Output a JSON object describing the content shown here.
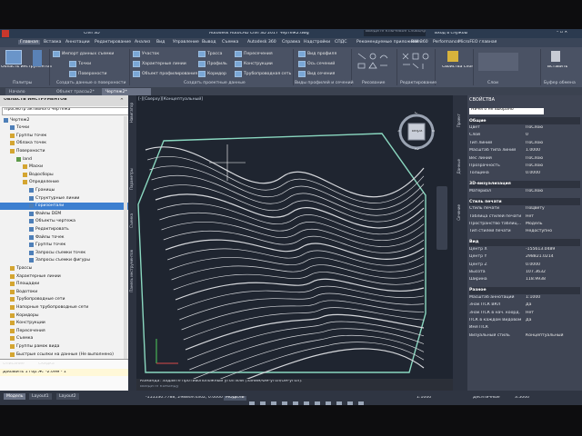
{
  "app": {
    "title": "Autodesk AutoCAD Civil 3D 2017    Чертеж2.dwg",
    "quick_title": "Civil 3D",
    "search_placeholder": "Введите ключевое слово/фразу",
    "signin": "Вход в службы"
  },
  "ribbon": {
    "tabs": [
      "Главная",
      "Вставка",
      "Аннотации",
      "Редактирование",
      "Анализ",
      "Вид",
      "Управление",
      "Вывод",
      "Съемка",
      "Autodesk 360",
      "Справка",
      "Надстройки",
      "СПДС",
      "Рекомендуемые приложения",
      "BIM 360",
      "Performance",
      "MicroFEO главная"
    ],
    "active_tab": "Главная",
    "groups": {
      "palettes": {
        "label": "Палитры",
        "big_button": "Область инструментов"
      },
      "create_ground": {
        "label": "Создать данные о поверхности",
        "buttons": [
          "Импорт данных съемки",
          "Точки",
          "Поверхности"
        ]
      },
      "create_design": {
        "label": "Создать проектные данные",
        "buttons": [
          "Участок",
          "Характерные линии",
          "Объект профилирования",
          "Трасса",
          "Профиль",
          "Коридор",
          "Пересечения",
          "Конструкции",
          "Трубопроводная сеть"
        ]
      },
      "profile_section": {
        "label": "Виды профилей и сечений",
        "buttons": [
          "Вид профиля",
          "Ось сечений",
          "Вид сечения"
        ]
      },
      "draw": {
        "label": "Рисование"
      },
      "modify": {
        "label": "Редактирование"
      },
      "layers": {
        "label": "Слои",
        "button": "Свойства слоя"
      },
      "clipboard": {
        "label": "Буфер обмена",
        "button": "Вставить"
      }
    }
  },
  "doc_tabs": [
    "Начало",
    "Объект трассы2*",
    "Чертеж2*"
  ],
  "doc_tabs_active": 2,
  "toolspace": {
    "header": "ОБЛАСТЬ ИНСТРУМЕНТОВ",
    "subheader": "Просмотр активного чертежа",
    "tree": [
      {
        "label": "Чертеж2",
        "indent": 0,
        "icon": "drawing-icon"
      },
      {
        "label": "Точки",
        "indent": 1,
        "icon": "points-icon"
      },
      {
        "label": "Группы точек",
        "indent": 1,
        "icon": "folder-icon"
      },
      {
        "label": "Облака точек",
        "indent": 1,
        "icon": "folder-icon"
      },
      {
        "label": "Поверхности",
        "indent": 1,
        "icon": "folder-icon"
      },
      {
        "label": "land",
        "indent": 2,
        "icon": "surface-icon"
      },
      {
        "label": "Маски",
        "indent": 3,
        "icon": "folder-icon"
      },
      {
        "label": "Водосборы",
        "indent": 3,
        "icon": "folder-icon"
      },
      {
        "label": "Определение",
        "indent": 3,
        "icon": "folder-icon"
      },
      {
        "label": "Границы",
        "indent": 4,
        "icon": "item-icon"
      },
      {
        "label": "Структурные линии",
        "indent": 4,
        "icon": "item-icon"
      },
      {
        "label": "Горизонтали",
        "indent": 4,
        "icon": "item-icon",
        "selected": true
      },
      {
        "label": "Файлы DEM",
        "indent": 4,
        "icon": "item-icon"
      },
      {
        "label": "Объекты чертежа",
        "indent": 4,
        "icon": "item-icon"
      },
      {
        "label": "Редактировать",
        "indent": 4,
        "icon": "item-icon"
      },
      {
        "label": "Файлы точек",
        "indent": 4,
        "icon": "item-icon"
      },
      {
        "label": "Группы точек",
        "indent": 4,
        "icon": "item-icon"
      },
      {
        "label": "Запросы съемки точек",
        "indent": 4,
        "icon": "item-icon"
      },
      {
        "label": "Запросы съемки фигуры",
        "indent": 4,
        "icon": "item-icon"
      },
      {
        "label": "Трассы",
        "indent": 1,
        "icon": "folder-icon"
      },
      {
        "label": "Характерные линии",
        "indent": 1,
        "icon": "folder-icon"
      },
      {
        "label": "Площадки",
        "indent": 1,
        "icon": "folder-icon"
      },
      {
        "label": "Водотоки",
        "indent": 1,
        "icon": "folder-icon"
      },
      {
        "label": "Трубопроводные сети",
        "indent": 1,
        "icon": "folder-icon"
      },
      {
        "label": "Напорные трубопроводные сети",
        "indent": 1,
        "icon": "folder-icon"
      },
      {
        "label": "Коридоры",
        "indent": 1,
        "icon": "folder-icon"
      },
      {
        "label": "Конструкции",
        "indent": 1,
        "icon": "folder-icon"
      },
      {
        "label": "Пересечения",
        "indent": 1,
        "icon": "folder-icon"
      },
      {
        "label": "Съемка",
        "indent": 1,
        "icon": "folder-icon"
      },
      {
        "label": "Группы рамок вида",
        "indent": 1,
        "icon": "folder-icon"
      },
      {
        "label": "Быстрые ссылки на данные (Не выполнено)",
        "indent": 1,
        "icon": "folder-icon"
      }
    ],
    "mini_table": {
      "headers": [
        "Описание",
        "Скидка"
      ],
      "row": [
        "Добавить 1 гор.",
        "Ж: -2.09м - 1"
      ]
    }
  },
  "left_vertical_tabs": [
    "Навигатор",
    "Параметры",
    "Съемка",
    "Панель инструментов"
  ],
  "drawing": {
    "view_label": "[-][Сверху][Концептуальный]",
    "viewcube": {
      "top": "С",
      "bottom": "Ю",
      "left": "З",
      "right": "В",
      "face": "Верх"
    },
    "colors": {
      "background": "#1f2530",
      "contour": "#d6d8dc",
      "boundary": "#8ad8c0"
    }
  },
  "command": {
    "history": "Команда: Задайте противоположный угол или [Заним/Фм-угол/Ом-угол]:",
    "placeholder": "Введите команду"
  },
  "properties": {
    "title": "СВОЙСТВА",
    "selection": "Ничего не выбрано",
    "sections": [
      {
        "name": "Общие",
        "rows": [
          [
            "Цвет",
            "ПоСлою"
          ],
          [
            "Слой",
            "0"
          ],
          [
            "Тип линий",
            "ПоСлою"
          ],
          [
            "Масштаб типа линий",
            "1.0000"
          ],
          [
            "Вес линий",
            "ПоСлою"
          ],
          [
            "Прозрачность",
            "ПоСлою"
          ],
          [
            "Толщина",
            "0.0000"
          ]
        ]
      },
      {
        "name": "3D-визуализация",
        "rows": [
          [
            "Материал",
            "ПоСлою"
          ]
        ]
      },
      {
        "name": "Стиль печати",
        "rows": [
          [
            "Стиль печати",
            "ПоЦвету"
          ],
          [
            "Таблица стилей печати",
            "Нет"
          ],
          [
            "Пространство таблиц...",
            "Модель"
          ],
          [
            "Тип стилей печати",
            "Недоступно"
          ]
        ]
      },
      {
        "name": "Вид",
        "rows": [
          [
            "Центр X",
            "-155613.0489"
          ],
          [
            "Центр Y",
            "298821.0214"
          ],
          [
            "Центр Z",
            "0.0000"
          ],
          [
            "Высота",
            "107.3632"
          ],
          [
            "Ширина",
            "118.9938"
          ]
        ]
      },
      {
        "name": "Разное",
        "rows": [
          [
            "Масштаб аннотаций",
            "1:1000"
          ],
          [
            "Знак ПСК ВКЛ",
            "Да"
          ],
          [
            "Знак ПСК в нач. коорд.",
            "Нет"
          ],
          [
            "ПСК в каждом Видовом",
            "Да"
          ],
          [
            "Имя ПСК",
            ""
          ],
          [
            "Визуальный стиль",
            "Концептуальный"
          ]
        ]
      }
    ],
    "vertical_tabs": [
      "Проект",
      "Данные",
      "Сечение"
    ]
  },
  "status": {
    "layout_tabs": [
      "Модель",
      "Layout1",
      "Layout2"
    ],
    "active_layout": "Модель",
    "coords": "-155530.7788, 298849.4302, 0.0000",
    "mode": "МОДЕЛЬ",
    "scale": "1:1000",
    "value": "3.5000",
    "units": "Десятичные"
  }
}
